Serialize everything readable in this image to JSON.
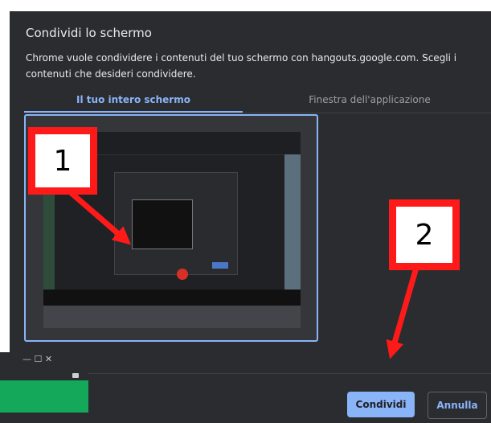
{
  "dialog": {
    "title": "Condividi lo schermo",
    "description": "Chrome vuole condividere i contenuti del tuo schermo con hangouts.google.com. Scegli i contenuti che desideri condividere.",
    "tabs": [
      {
        "label": "Il tuo intero schermo",
        "selected": true
      },
      {
        "label": "Finestra dell'applicazione",
        "selected": false
      }
    ],
    "buttons": {
      "share": "Condividi",
      "cancel": "Annulla"
    }
  },
  "background_window": {
    "controls": "—   ☐   ✕"
  },
  "annotations": [
    {
      "label": "1",
      "color": "#ff1a1a"
    },
    {
      "label": "2",
      "color": "#ff1a1a"
    }
  ],
  "colors": {
    "dialog_bg": "#2b2c2f",
    "accent": "#8ab4f8",
    "annotation": "#ff1a1a"
  }
}
